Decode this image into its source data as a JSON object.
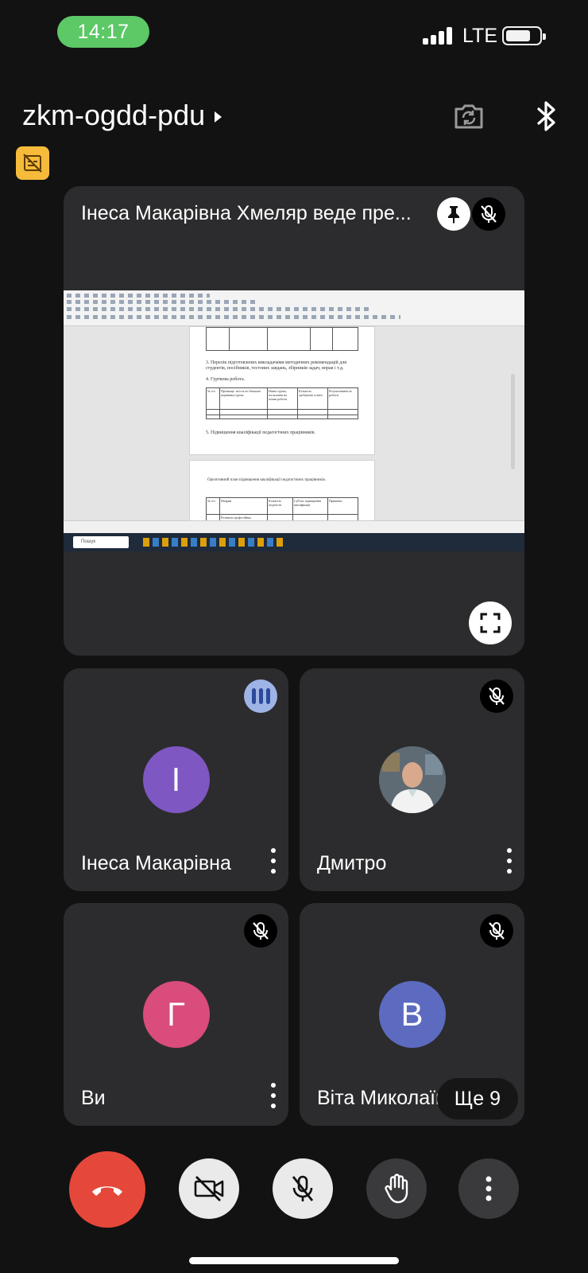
{
  "status_bar": {
    "time": "14:17",
    "network": "LTE"
  },
  "header": {
    "meeting_code": "zkm-ogdd-pdu"
  },
  "presentation_tile": {
    "title": "Інеса Макарівна Хмеляр веде пре...",
    "shared_screen": {
      "taskbar_search": "Пошук",
      "doc_lines": {
        "item3": "3. Перелік підготовлених викладачами методичних рекомендацій для студентів, посібників, тестових завдань, збірників задач, вправ і т.д.",
        "item4": "4. Гурткова робота.",
        "col1": "№ з/п",
        "col2": "Прізвище, ім'я та по-батькові керівника гуртка",
        "col3": "Назва гуртка, посилання на плани роботи",
        "col4": "Кількість здобувачів освіти",
        "col5": "Результативність роботи",
        "item5": "5. Підвищення кваліфікації педагогічних працівників.",
        "plan_title": "Орієнтовний план підвищення кваліфікації педагогічних працівників.",
        "p2_col1": "№ з/п",
        "p2_col2": "Напрям",
        "p2_col3": "Кількість педагогів",
        "p2_col4": "Суб'єкт підвищення кваліфікації",
        "p2_col5": "Примітки",
        "p2_row1": "Розвиток професійних"
      }
    }
  },
  "participants": [
    {
      "name": "Інеса Макарівна",
      "initial": "І",
      "color": "#7e57c2",
      "speaking": true
    },
    {
      "name": "Дмитро",
      "initial": "",
      "color": "#6b6b6b",
      "muted": true
    },
    {
      "name": "Ви",
      "initial": "Г",
      "color": "#d94c7c",
      "muted": true
    },
    {
      "name": "Віта Миколаїв",
      "initial": "В",
      "color": "#5c6bc0",
      "muted": true
    }
  ],
  "more_participants": "Ще 9",
  "colors": {
    "end_call": "#e5483a",
    "status_pill": "#5cc866",
    "captions_badge": "#f6bb3b",
    "tile": "#2c2c2e"
  }
}
